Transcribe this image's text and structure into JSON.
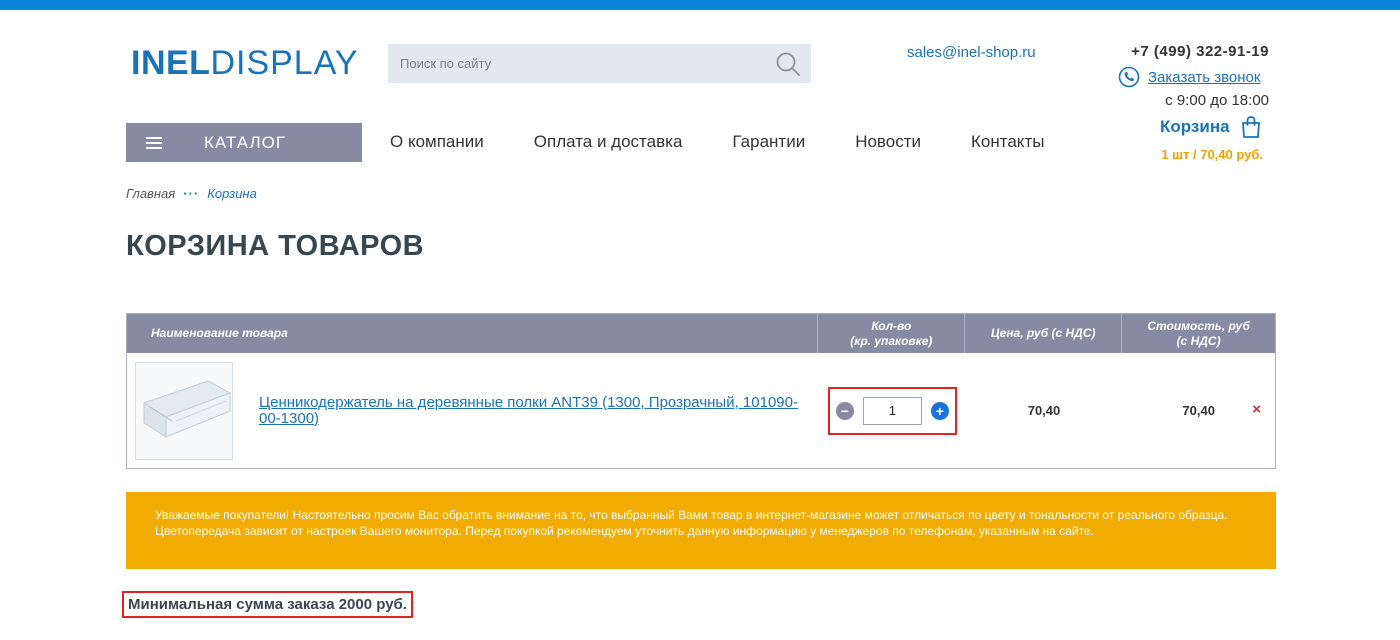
{
  "header": {
    "logo_part1": "INEL",
    "logo_part2": "DISPLAY",
    "search_placeholder": "Поиск по сайту",
    "email": "sales@inel-shop.ru",
    "phone": "+7 (499) 322-91-19",
    "callback_label": "Заказать звонок",
    "hours": "с 9:00 до 18:00",
    "cart_label": "Корзина",
    "cart_summary": "1 шт / 70,40 руб."
  },
  "nav": {
    "catalog_label": "КАТАЛОГ",
    "items": [
      "О компании",
      "Оплата и доставка",
      "Гарантии",
      "Новости",
      "Контакты"
    ]
  },
  "breadcrumb": {
    "home": "Главная",
    "separator": "···",
    "current": "Корзина"
  },
  "page_title": "КОРЗИНА ТОВАРОВ",
  "table": {
    "headers": {
      "name": "Наименование товара",
      "qty_line1": "Кол-во",
      "qty_line2": "(кр. упаковке)",
      "price": "Цена, руб (с НДС)",
      "cost_line1": "Стоимость, руб",
      "cost_line2": "(с НДС)"
    },
    "rows": [
      {
        "name": "Ценникодержатель на деревянные полки ANT39 (1300, Прозрачный, 101090-00-1300)",
        "qty": "1",
        "price": "70,40",
        "cost": "70,40",
        "minus": "−",
        "plus": "+",
        "remove": "×"
      }
    ]
  },
  "notice": "Уважаемые покупатели! Настоятельно просим Вас обратить внимание на то, что выбранный Вами товар в интернет-магазине может отличаться по цвету и тональности от реального образца. Цветопередача зависит от настроек Вашего монитора. Перед покупкой рекомендуем уточнить данную информацию у менеджеров по телефонам, указанным на сайте.",
  "min_order": "Минимальная сумма заказа 2000 руб.",
  "colors": {
    "accent_blue": "#1a73b8",
    "top_bar": "#0a85d9",
    "nav_purple": "#878aa3",
    "notice_orange": "#f2ab00",
    "highlight_red": "#e32323"
  },
  "icons": {
    "search": "search-icon",
    "phone": "phone-icon",
    "cart": "shopping-bag-icon",
    "menu": "hamburger-icon",
    "remove": "close-icon"
  }
}
